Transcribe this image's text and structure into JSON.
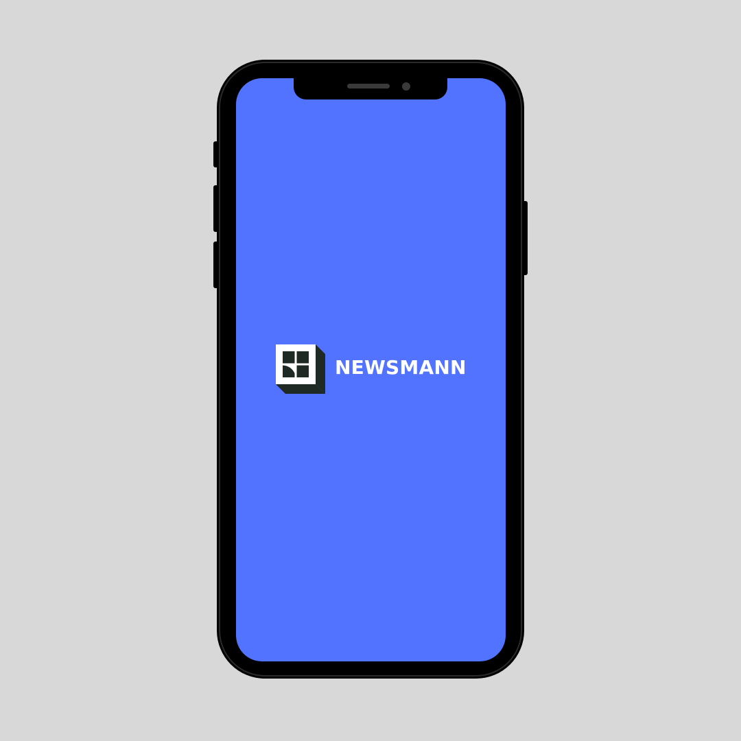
{
  "app": {
    "brand_name": "NEWSMANN",
    "logo_icon": "newsmann-logo-icon"
  },
  "colors": {
    "background": "#d8d8d8",
    "screen": "#5273ff",
    "phone_frame": "#000000",
    "logo_dark": "#1f2a24",
    "brand_text": "#ffffff"
  }
}
